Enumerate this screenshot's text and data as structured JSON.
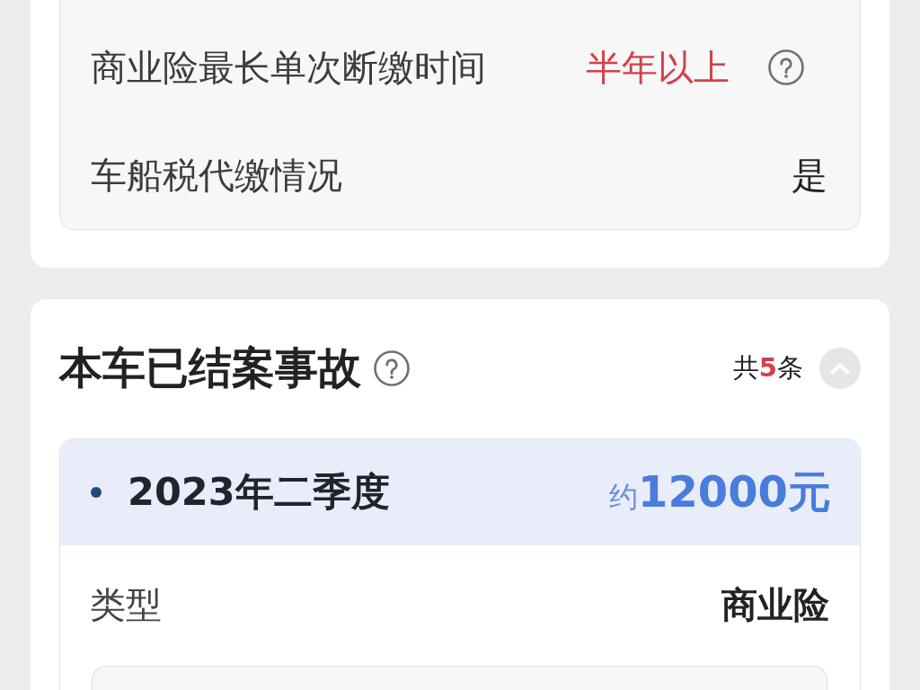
{
  "insurance": {
    "rows": [
      {
        "label": "商业险最长单次断缴时间",
        "value": "半年以上",
        "warning": true,
        "help": true
      },
      {
        "label": "车船税代缴情况",
        "value": "是",
        "warning": false,
        "help": false
      }
    ]
  },
  "accidents": {
    "title": "本车已结案事故",
    "help": true,
    "count": "共**5**条",
    "expanded": true,
    "items": [
      {
        "period": "2023年二季度",
        "amount": "约**12000元**",
        "fields": [
          {
            "label": "类型",
            "value": "商业险"
          }
        ]
      }
    ]
  }
}
